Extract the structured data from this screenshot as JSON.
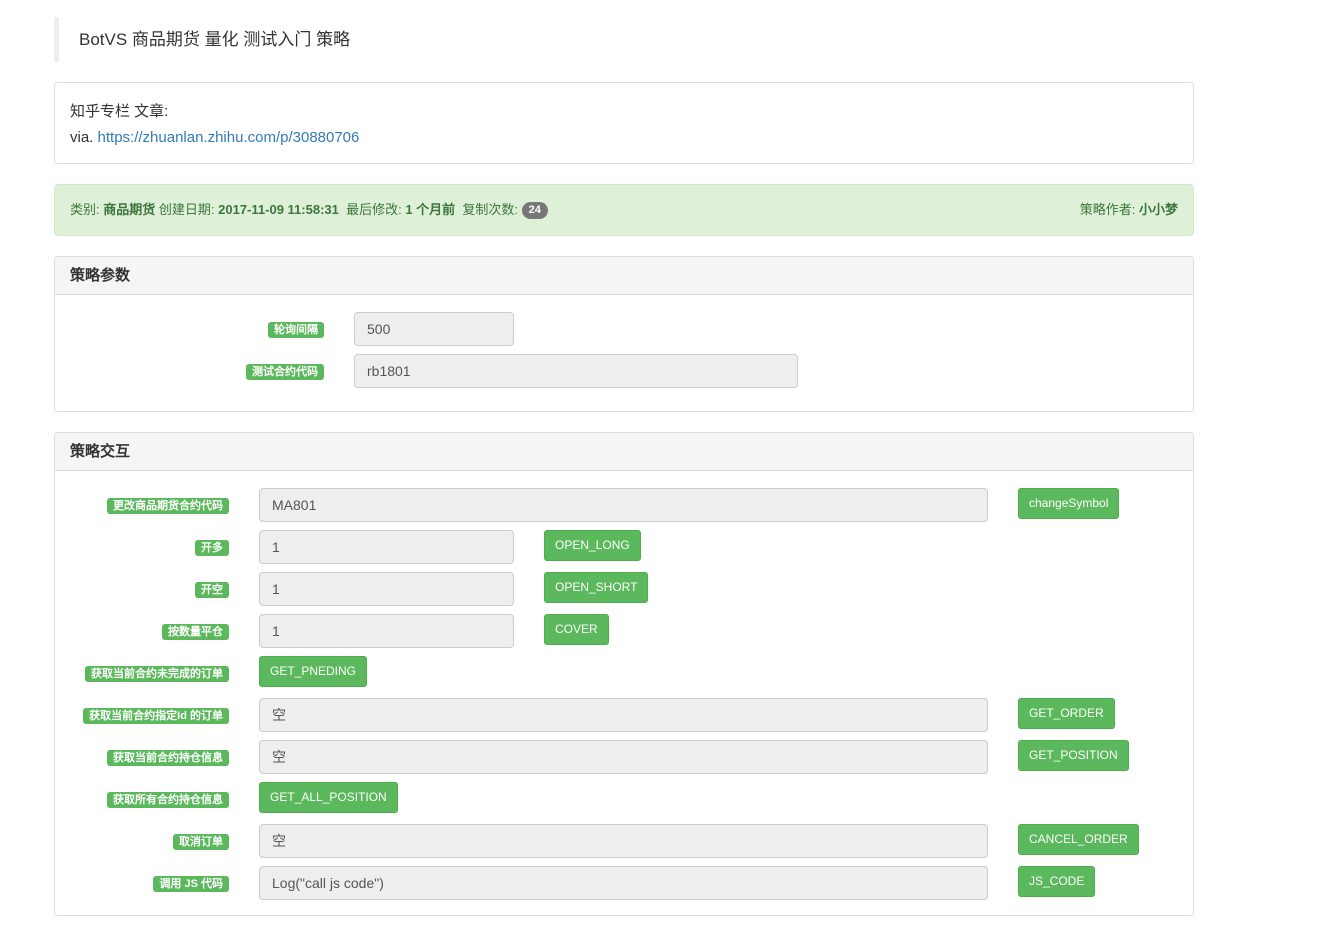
{
  "title": "BotVS 商品期货 量化 测试入门 策略",
  "description": {
    "line1": "知乎专栏 文章:",
    "via": "via.",
    "link": "https://zhuanlan.zhihu.com/p/30880706"
  },
  "info": {
    "category_label": "类别:",
    "category": "商品期货",
    "created_label": "创建日期:",
    "created": "2017-11-09 11:58:31",
    "modified_label": "最后修改:",
    "modified": "1 个月前",
    "copies_label": "复制次数:",
    "copies": "24",
    "author_label": "策略作者:",
    "author": "小小梦"
  },
  "params": {
    "heading": "策略参数",
    "items": [
      {
        "label": "轮询间隔",
        "value": "500"
      },
      {
        "label": "测试合约代码",
        "value": "rb1801"
      }
    ]
  },
  "interaction": {
    "heading": "策略交互",
    "rows": [
      {
        "label": "更改商品期货合约代码",
        "value": "MA801",
        "input": "full",
        "button": "changeSymbol"
      },
      {
        "label": "开多",
        "value": "1",
        "input": "short",
        "button": "OPEN_LONG"
      },
      {
        "label": "开空",
        "value": "1",
        "input": "short",
        "button": "OPEN_SHORT"
      },
      {
        "label": "按数量平仓",
        "value": "1",
        "input": "short",
        "button": "COVER"
      },
      {
        "label": "获取当前合约未完成的订单",
        "input": "none",
        "button": "GET_PNEDING"
      },
      {
        "label": "获取当前合约指定Id 的订单",
        "value": "空",
        "input": "full",
        "button": "GET_ORDER"
      },
      {
        "label": "获取当前合约持仓信息",
        "value": "空",
        "input": "full",
        "button": "GET_POSITION"
      },
      {
        "label": "获取所有合约持仓信息",
        "input": "none",
        "button": "GET_ALL_POSITION"
      },
      {
        "label": "取消订单",
        "value": "空",
        "input": "full",
        "button": "CANCEL_ORDER"
      },
      {
        "label": "调用 JS 代码",
        "value": "Log(\"call js code\")",
        "input": "full",
        "button": "JS_CODE"
      }
    ]
  }
}
